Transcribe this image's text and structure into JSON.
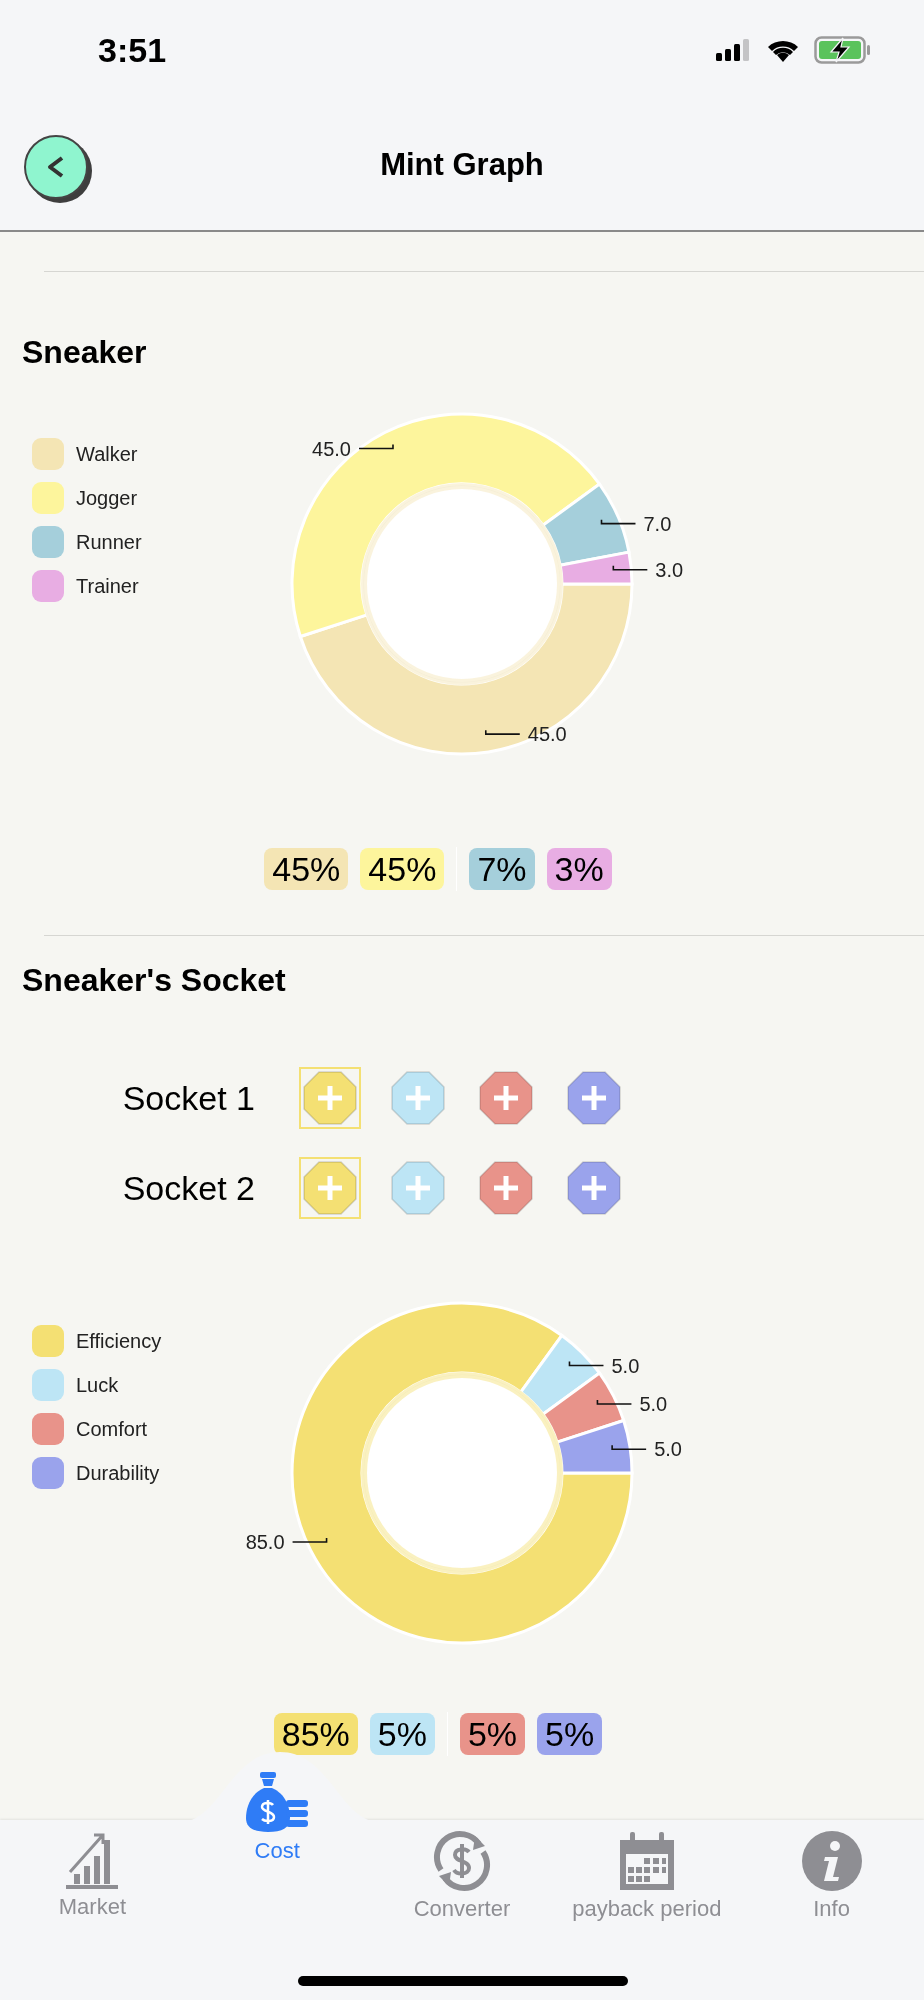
{
  "status_bar": {
    "time": "3:51"
  },
  "nav": {
    "title": "Mint Graph"
  },
  "sections": [
    {
      "title": "Sneaker",
      "legend": [
        {
          "color": "#f4e5b4"
        },
        {
          "color": "#fdf59c"
        },
        {
          "color": "#a5cfdb"
        },
        {
          "color": "#e8ade3"
        }
      ],
      "chart_data": {
        "type": "donut",
        "categories": [
          "Walker",
          "Jogger",
          "Runner",
          "Trainer"
        ],
        "values": [
          45,
          45,
          7,
          3
        ],
        "value_labels": [
          "45.0",
          "45.0",
          "7.0",
          "3.0"
        ]
      },
      "chips": [
        {
          "label": "45%",
          "color": "#f4e5b4"
        },
        {
          "label": "45%",
          "color": "#fdf59c"
        },
        {
          "label": "7%",
          "color": "#a5cfdb"
        },
        {
          "label": "3%",
          "color": "#e8ade3"
        }
      ]
    },
    {
      "title": "Sneaker's Socket",
      "sockets": [
        {
          "label": "Socket 1",
          "slots": [
            {
              "color": "#f4e073",
              "selected": true
            },
            {
              "color": "#bde5f5",
              "selected": false
            },
            {
              "color": "#e8938a",
              "selected": false
            },
            {
              "color": "#9aa3ec",
              "selected": false
            }
          ]
        },
        {
          "label": "Socket 2",
          "slots": [
            {
              "color": "#f4e073",
              "selected": true
            },
            {
              "color": "#bde5f5",
              "selected": false
            },
            {
              "color": "#e8938a",
              "selected": false
            },
            {
              "color": "#9aa3ec",
              "selected": false
            }
          ]
        }
      ],
      "legend": [
        {
          "color": "#f4e073"
        },
        {
          "color": "#bde5f5"
        },
        {
          "color": "#e8938a"
        },
        {
          "color": "#9aa3ec"
        }
      ],
      "chart_data": {
        "type": "donut",
        "categories": [
          "Efficiency",
          "Luck",
          "Comfort",
          "Durability"
        ],
        "values": [
          85,
          5,
          5,
          5
        ],
        "value_labels": [
          "85.0",
          "5.0",
          "5.0",
          "5.0"
        ]
      },
      "chips": [
        {
          "label": "85%",
          "color": "#f4e073"
        },
        {
          "label": "5%",
          "color": "#bde5f5"
        },
        {
          "label": "5%",
          "color": "#e8938a"
        },
        {
          "label": "5%",
          "color": "#9aa3ec"
        }
      ]
    }
  ],
  "tabs": [
    {
      "label": "Market",
      "selected": false
    },
    {
      "label": "Cost",
      "selected": true
    },
    {
      "label": "Converter",
      "selected": false
    },
    {
      "label": "payback period",
      "selected": false
    },
    {
      "label": "Info",
      "selected": false
    }
  ]
}
